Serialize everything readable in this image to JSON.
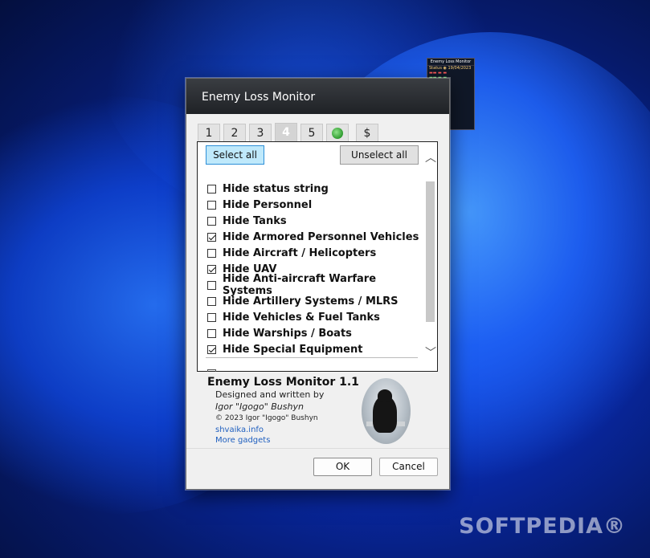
{
  "dialog": {
    "title": "Enemy Loss Monitor",
    "tabs": [
      "1",
      "2",
      "3",
      "4",
      "5",
      "",
      "$"
    ],
    "active_tab": "4",
    "tab_icons": {
      "refresh": "refresh-icon"
    },
    "select_all": "Select all",
    "unselect_all": "Unselect all",
    "items": [
      {
        "label": "Hide status string",
        "checked": false
      },
      {
        "label": "Hide Personnel",
        "checked": false
      },
      {
        "label": "Hide Tanks",
        "checked": false
      },
      {
        "label": "Hide Armored Personnel Vehicles",
        "checked": true
      },
      {
        "label": "Hide Aircraft / Helicopters",
        "checked": false
      },
      {
        "label": "Hide UAV",
        "checked": true
      },
      {
        "label": "Hide Anti-aircraft Warfare Systems",
        "checked": false
      },
      {
        "label": "Hide Artillery Systems / MLRS",
        "checked": false
      },
      {
        "label": "Hide Vehicles & Fuel Tanks",
        "checked": false
      },
      {
        "label": "Hide Warships / Boats",
        "checked": false
      },
      {
        "label": "Hide Special Equipment",
        "checked": true
      }
    ],
    "about": {
      "name": "Enemy Loss Monitor 1.1",
      "designed": "Designed and written by",
      "author": "Igor \"Igogo\" Bushyn",
      "copyright": "© 2023 Igor \"Igogo\" Bushyn",
      "site": "shvaika.info",
      "more": "More gadgets"
    },
    "ok": "OK",
    "cancel": "Cancel"
  },
  "gadget": {
    "title": "Enemy Loss Monitor",
    "status": "Status ◉ 19/04/2023"
  },
  "watermark": "SOFTPEDIA®",
  "colors": {
    "accent": "#2d8fd8",
    "titlebar": "#1f2226",
    "select_bg": "#bfe9fb"
  }
}
